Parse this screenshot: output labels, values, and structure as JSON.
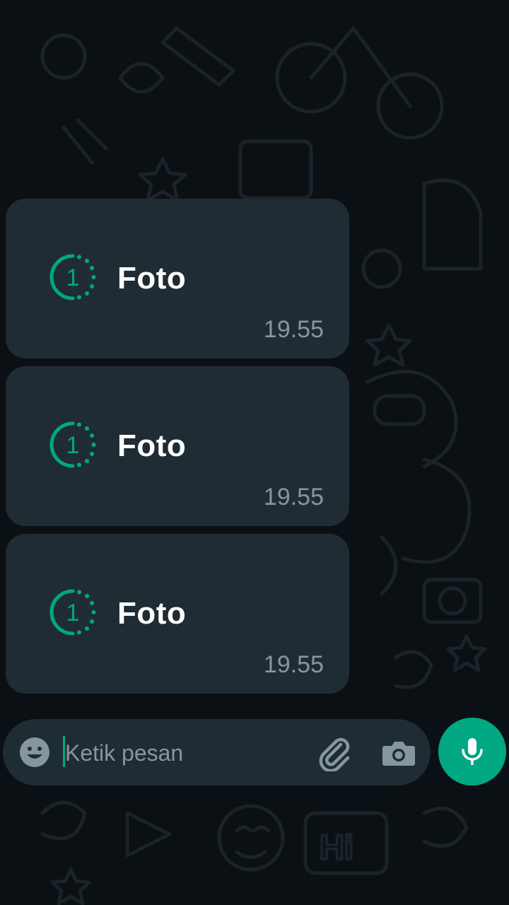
{
  "messages": [
    {
      "label": "Foto",
      "time": "19.55",
      "icon": "view-once-icon"
    },
    {
      "label": "Foto",
      "time": "19.55",
      "icon": "view-once-icon"
    },
    {
      "label": "Foto",
      "time": "19.55",
      "icon": "view-once-icon"
    }
  ],
  "view_once_badge": "1",
  "composer": {
    "placeholder": "Ketik pesan",
    "value": "",
    "emoji_icon": "emoji-icon",
    "attach_icon": "paperclip-icon",
    "camera_icon": "camera-icon",
    "send_icon": "microphone-icon"
  },
  "colors": {
    "background": "#0b1014",
    "bubble": "#202c33",
    "accent": "#00a884",
    "time_text": "#8696a0",
    "input_bar": "#1f2c34"
  }
}
